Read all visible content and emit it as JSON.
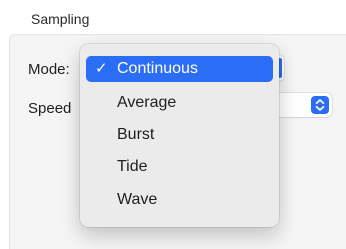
{
  "section": {
    "title": "Sampling"
  },
  "form": {
    "mode_label": "Mode:",
    "speed_label": "Speed"
  },
  "mode_menu": {
    "selected": "Continuous",
    "items": [
      {
        "label": "Continuous",
        "selected": true
      },
      {
        "label": "Average",
        "selected": false
      },
      {
        "label": "Burst",
        "selected": false
      },
      {
        "label": "Tide",
        "selected": false
      },
      {
        "label": "Wave",
        "selected": false
      }
    ],
    "check_glyph": "✓"
  },
  "colors": {
    "accent": "#2c6df5",
    "menu_bg": "#ebebeb",
    "panel_bg": "#f5f5f5"
  },
  "icons": {
    "selected_item": "checkmark-icon",
    "speed_popup": "up-down-chevron-icon"
  }
}
